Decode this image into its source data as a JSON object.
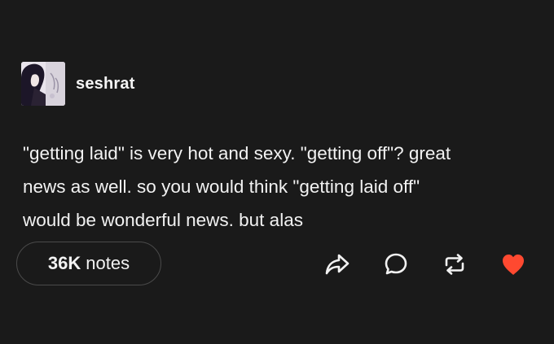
{
  "post": {
    "username": "seshrat",
    "body_lines": [
      "\"getting laid\" is very hot and sexy. \"getting off\"? great",
      "news as well. so you would think \"getting laid off\"",
      "would be wonderful news. but alas"
    ],
    "notes_count": "36K",
    "notes_label": "notes"
  },
  "actions": {
    "icons": [
      "share-icon",
      "reply-icon",
      "reblog-icon",
      "like-icon"
    ]
  },
  "colors": {
    "background": "#1a1a1a",
    "text": "#f2f2f2",
    "like_active": "#ff4930",
    "pill_border": "#4a4a4a"
  }
}
